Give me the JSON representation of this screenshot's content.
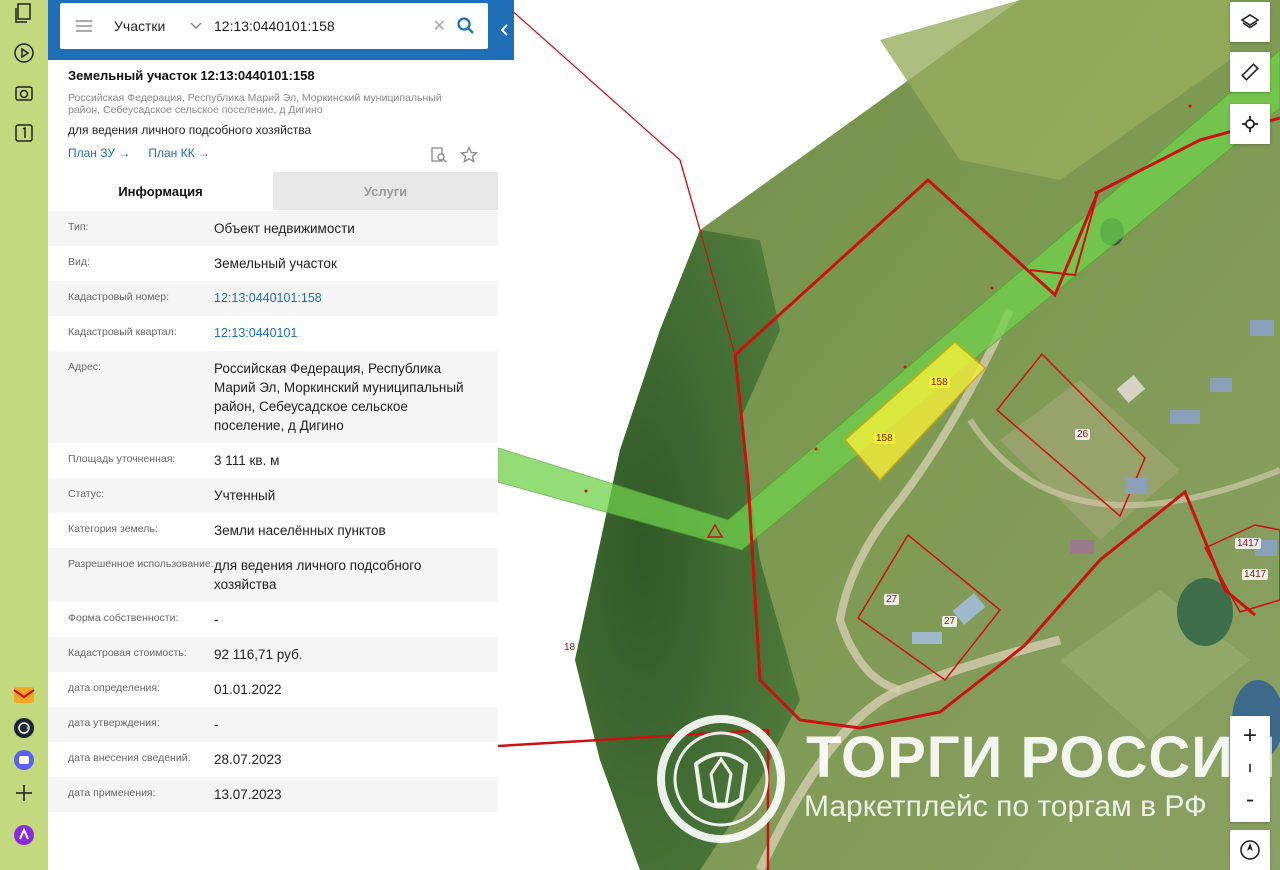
{
  "search": {
    "type_label": "Участки",
    "value": "12:13:0440101:158"
  },
  "object": {
    "title": "Земельный участок 12:13:0440101:158",
    "address": "Российская Федерация, Республика Марий Эл, Моркинский муниципальный район, Себеусадское сельское поселение, д Дигино",
    "purpose": "для ведения личного подсобного хозяйства",
    "link_plan_zu": "План ЗУ",
    "link_plan_kk": "План КК"
  },
  "tabs": [
    {
      "label": "Информация",
      "active": true
    },
    {
      "label": "Услуги",
      "active": false
    }
  ],
  "properties": [
    {
      "label": "Тип:",
      "value": "Объект недвижимости",
      "link": false
    },
    {
      "label": "Вид:",
      "value": "Земельный участок",
      "link": false
    },
    {
      "label": "Кадастровый номер:",
      "value": "12:13:0440101:158",
      "link": true
    },
    {
      "label": "Кадастровый квартал:",
      "value": "12:13:0440101",
      "link": true
    },
    {
      "label": "Адрес:",
      "value": "Российская Федерация, Республика Марий Эл, Моркинский муниципальный район, Себеусадское сельское поселение, д Дигино",
      "link": false
    },
    {
      "label": "Площадь уточненная:",
      "value": "3 111 кв. м",
      "link": false
    },
    {
      "label": "Статус:",
      "value": "Учтенный",
      "link": false
    },
    {
      "label": "Категория земель:",
      "value": "Земли населённых пунктов",
      "link": false
    },
    {
      "label": "Разрешенное использование:",
      "value": "для ведения личного подсобного хозяйства",
      "link": false
    },
    {
      "label": "Форма собственности:",
      "value": "-",
      "link": false
    },
    {
      "label": "Кадастровая стоимость:",
      "value": "92 116,71 руб.",
      "link": false
    },
    {
      "label": "дата определения:",
      "value": "01.01.2022",
      "link": false
    },
    {
      "label": "дата утверждения:",
      "value": "-",
      "link": false
    },
    {
      "label": "дата внесения сведений:",
      "value": "28.07.2023",
      "link": false
    },
    {
      "label": "дата применения:",
      "value": "13.07.2023",
      "link": false
    }
  ],
  "map_labels": {
    "p158a": "158",
    "p158b": "158",
    "p26": "26",
    "p27a": "27",
    "p27b": "27",
    "p18": "18",
    "p1417a": "1417",
    "p1417b": "1417"
  },
  "zoom_controls": {
    "plus": "+",
    "minus": "-"
  },
  "watermark": {
    "title": "ТОРГИ РОССИИ",
    "subtitle": "Маркетплейс по торгам в РФ"
  },
  "colors": {
    "header_blue": "#1e6fb8",
    "sidebar_green": "#c4d87d",
    "parcel_red": "#cc1010",
    "highlight_yellow": "#f5f03a",
    "corridor_green": "#6fd24a"
  }
}
